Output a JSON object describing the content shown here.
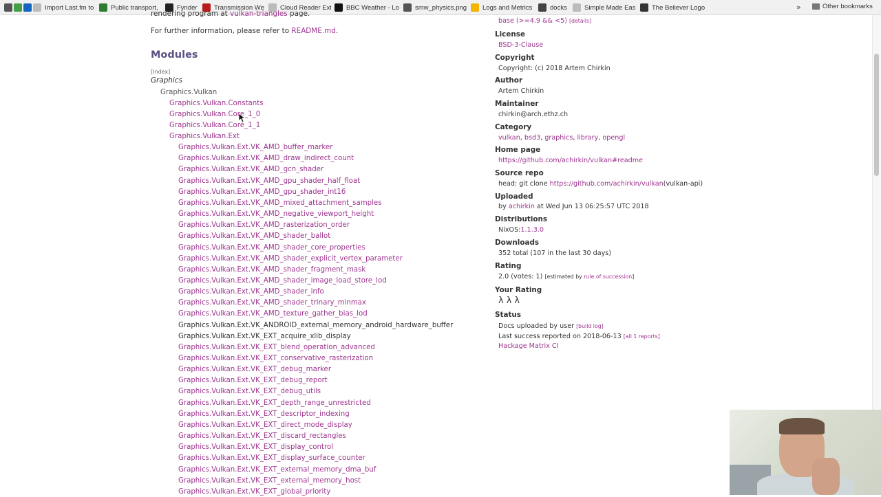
{
  "bookmarks": [
    {
      "label": "",
      "icon": "apps-icon",
      "color": "#555555",
      "w": 14
    },
    {
      "label": "",
      "icon": "greenhouse-icon",
      "color": "#43a047",
      "w": 14
    },
    {
      "label": "",
      "icon": "trello-icon",
      "color": "#1565c0",
      "w": 14
    },
    {
      "label": "Import Last.fm to",
      "icon": "page-icon",
      "color": "#bbbbbb",
      "w": 96
    },
    {
      "label": "Public transport,",
      "icon": "plus-icon",
      "color": "#2e7d32",
      "w": 96
    },
    {
      "label": "Fynder",
      "icon": "github-icon",
      "color": "#222222",
      "w": 54
    },
    {
      "label": "Transmission We",
      "icon": "transmission-icon",
      "color": "#b71c1c",
      "w": 96
    },
    {
      "label": "Cloud Reader Ext",
      "icon": "page-icon",
      "color": "#bbbbbb",
      "w": 96
    },
    {
      "label": "BBC Weather - Lo",
      "icon": "bbc-icon",
      "color": "#111111",
      "w": 100
    },
    {
      "label": "smw_physics.png",
      "icon": "image-icon",
      "color": "#555555",
      "w": 98
    },
    {
      "label": "Logs and Metrics",
      "icon": "metrics-icon",
      "color": "#f4b400",
      "w": 98
    },
    {
      "label": "docks",
      "icon": "docks-icon",
      "color": "#444444",
      "w": 50
    },
    {
      "label": "Simple Made Eas",
      "icon": "page-icon",
      "color": "#bbbbbb",
      "w": 98
    },
    {
      "label": "The Believer Logo",
      "icon": "believer-icon",
      "color": "#333333",
      "w": 100
    }
  ],
  "bookmarks_more": "»",
  "other_bookmarks": "Other bookmarks",
  "intro": {
    "line1_text": "rendering program at ",
    "line1_link": "vulkan-triangles",
    "line1_end": " page.",
    "line2_text": "For further information, please refer to ",
    "line2_link": "README.md",
    "line2_end": "."
  },
  "modules_heading": "Modules",
  "index_link": "[Index]",
  "graphics_label": "Graphics",
  "modules": [
    {
      "name": "Graphics.Vulkan",
      "level": 1,
      "kind": "grp"
    },
    {
      "name": "Graphics.Vulkan.Constants",
      "level": 2,
      "kind": "lnk"
    },
    {
      "name": "Graphics.Vulkan.Core_1_0",
      "level": 2,
      "kind": "lnk"
    },
    {
      "name": "Graphics.Vulkan.Core_1_1",
      "level": 2,
      "kind": "lnk"
    },
    {
      "name": "Graphics.Vulkan.Ext",
      "level": 2,
      "kind": "lnk"
    },
    {
      "name": "Graphics.Vulkan.Ext.VK_AMD_buffer_marker",
      "level": 3,
      "kind": "lnk"
    },
    {
      "name": "Graphics.Vulkan.Ext.VK_AMD_draw_indirect_count",
      "level": 3,
      "kind": "lnk"
    },
    {
      "name": "Graphics.Vulkan.Ext.VK_AMD_gcn_shader",
      "level": 3,
      "kind": "lnk"
    },
    {
      "name": "Graphics.Vulkan.Ext.VK_AMD_gpu_shader_half_float",
      "level": 3,
      "kind": "lnk"
    },
    {
      "name": "Graphics.Vulkan.Ext.VK_AMD_gpu_shader_int16",
      "level": 3,
      "kind": "lnk"
    },
    {
      "name": "Graphics.Vulkan.Ext.VK_AMD_mixed_attachment_samples",
      "level": 3,
      "kind": "lnk"
    },
    {
      "name": "Graphics.Vulkan.Ext.VK_AMD_negative_viewport_height",
      "level": 3,
      "kind": "lnk"
    },
    {
      "name": "Graphics.Vulkan.Ext.VK_AMD_rasterization_order",
      "level": 3,
      "kind": "lnk"
    },
    {
      "name": "Graphics.Vulkan.Ext.VK_AMD_shader_ballot",
      "level": 3,
      "kind": "lnk"
    },
    {
      "name": "Graphics.Vulkan.Ext.VK_AMD_shader_core_properties",
      "level": 3,
      "kind": "lnk"
    },
    {
      "name": "Graphics.Vulkan.Ext.VK_AMD_shader_explicit_vertex_parameter",
      "level": 3,
      "kind": "lnk"
    },
    {
      "name": "Graphics.Vulkan.Ext.VK_AMD_shader_fragment_mask",
      "level": 3,
      "kind": "lnk"
    },
    {
      "name": "Graphics.Vulkan.Ext.VK_AMD_shader_image_load_store_lod",
      "level": 3,
      "kind": "lnk"
    },
    {
      "name": "Graphics.Vulkan.Ext.VK_AMD_shader_info",
      "level": 3,
      "kind": "lnk"
    },
    {
      "name": "Graphics.Vulkan.Ext.VK_AMD_shader_trinary_minmax",
      "level": 3,
      "kind": "lnk"
    },
    {
      "name": "Graphics.Vulkan.Ext.VK_AMD_texture_gather_bias_lod",
      "level": 3,
      "kind": "lnk"
    },
    {
      "name": "Graphics.Vulkan.Ext.VK_ANDROID_external_memory_android_hardware_buffer",
      "level": 3,
      "kind": "plain"
    },
    {
      "name": "Graphics.Vulkan.Ext.VK_EXT_acquire_xlib_display",
      "level": 3,
      "kind": "plain"
    },
    {
      "name": "Graphics.Vulkan.Ext.VK_EXT_blend_operation_advanced",
      "level": 3,
      "kind": "lnk"
    },
    {
      "name": "Graphics.Vulkan.Ext.VK_EXT_conservative_rasterization",
      "level": 3,
      "kind": "lnk"
    },
    {
      "name": "Graphics.Vulkan.Ext.VK_EXT_debug_marker",
      "level": 3,
      "kind": "lnk"
    },
    {
      "name": "Graphics.Vulkan.Ext.VK_EXT_debug_report",
      "level": 3,
      "kind": "lnk"
    },
    {
      "name": "Graphics.Vulkan.Ext.VK_EXT_debug_utils",
      "level": 3,
      "kind": "lnk"
    },
    {
      "name": "Graphics.Vulkan.Ext.VK_EXT_depth_range_unrestricted",
      "level": 3,
      "kind": "lnk"
    },
    {
      "name": "Graphics.Vulkan.Ext.VK_EXT_descriptor_indexing",
      "level": 3,
      "kind": "lnk"
    },
    {
      "name": "Graphics.Vulkan.Ext.VK_EXT_direct_mode_display",
      "level": 3,
      "kind": "lnk"
    },
    {
      "name": "Graphics.Vulkan.Ext.VK_EXT_discard_rectangles",
      "level": 3,
      "kind": "lnk"
    },
    {
      "name": "Graphics.Vulkan.Ext.VK_EXT_display_control",
      "level": 3,
      "kind": "lnk"
    },
    {
      "name": "Graphics.Vulkan.Ext.VK_EXT_display_surface_counter",
      "level": 3,
      "kind": "lnk"
    },
    {
      "name": "Graphics.Vulkan.Ext.VK_EXT_external_memory_dma_buf",
      "level": 3,
      "kind": "lnk"
    },
    {
      "name": "Graphics.Vulkan.Ext.VK_EXT_external_memory_host",
      "level": 3,
      "kind": "lnk"
    },
    {
      "name": "Graphics.Vulkan.Ext.VK_EXT_global_priority",
      "level": 3,
      "kind": "lnk"
    }
  ],
  "sidebar": {
    "base_line": "base (>=4.9 && <5)",
    "base_details": "[details]",
    "license_h": "License",
    "license_v": "BSD-3-Clause",
    "copyright_h": "Copyright",
    "copyright_v": "Copyright: (c) 2018 Artem Chirkin",
    "author_h": "Author",
    "author_v": "Artem Chirkin",
    "maintainer_h": "Maintainer",
    "maintainer_v": "chirkin@arch.ethz.ch",
    "category_h": "Category",
    "category_links": [
      "vulkan",
      "bsd3",
      "graphics",
      "library",
      "opengl"
    ],
    "homepage_h": "Home page",
    "homepage_v": "https://github.com/achirkin/vulkan#readme",
    "sourcerepo_h": "Source repo",
    "sourcerepo_prefix": "head: git clone ",
    "sourcerepo_link": "https://github.com/achirkin/vulkan",
    "sourcerepo_suffix": "(vulkan-api)",
    "uploaded_h": "Uploaded",
    "uploaded_by": "by ",
    "uploaded_user": "achirkin",
    "uploaded_at": " at Wed Jun 13 06:25:57 UTC 2018",
    "distributions_h": "Distributions",
    "distributions_prefix": "NixOS:",
    "distributions_link": "1.1.3.0",
    "downloads_h": "Downloads",
    "downloads_v": "352 total (107 in the last 30 days)",
    "rating_h": "Rating",
    "rating_v": "2.0 (votes: 1)",
    "rating_estimated": "[estimated by ",
    "rating_rule": "rule of succession",
    "rating_close": "]",
    "your_rating_h": "Your Rating",
    "lambda": "λ",
    "status_h": "Status",
    "status_docs": "Docs uploaded by user ",
    "status_buildlog": "[build log]",
    "status_success": "Last success reported on 2018-06-13 ",
    "status_reports": "[all 1 reports]",
    "status_matrix": "Hackage Matrix CI"
  }
}
